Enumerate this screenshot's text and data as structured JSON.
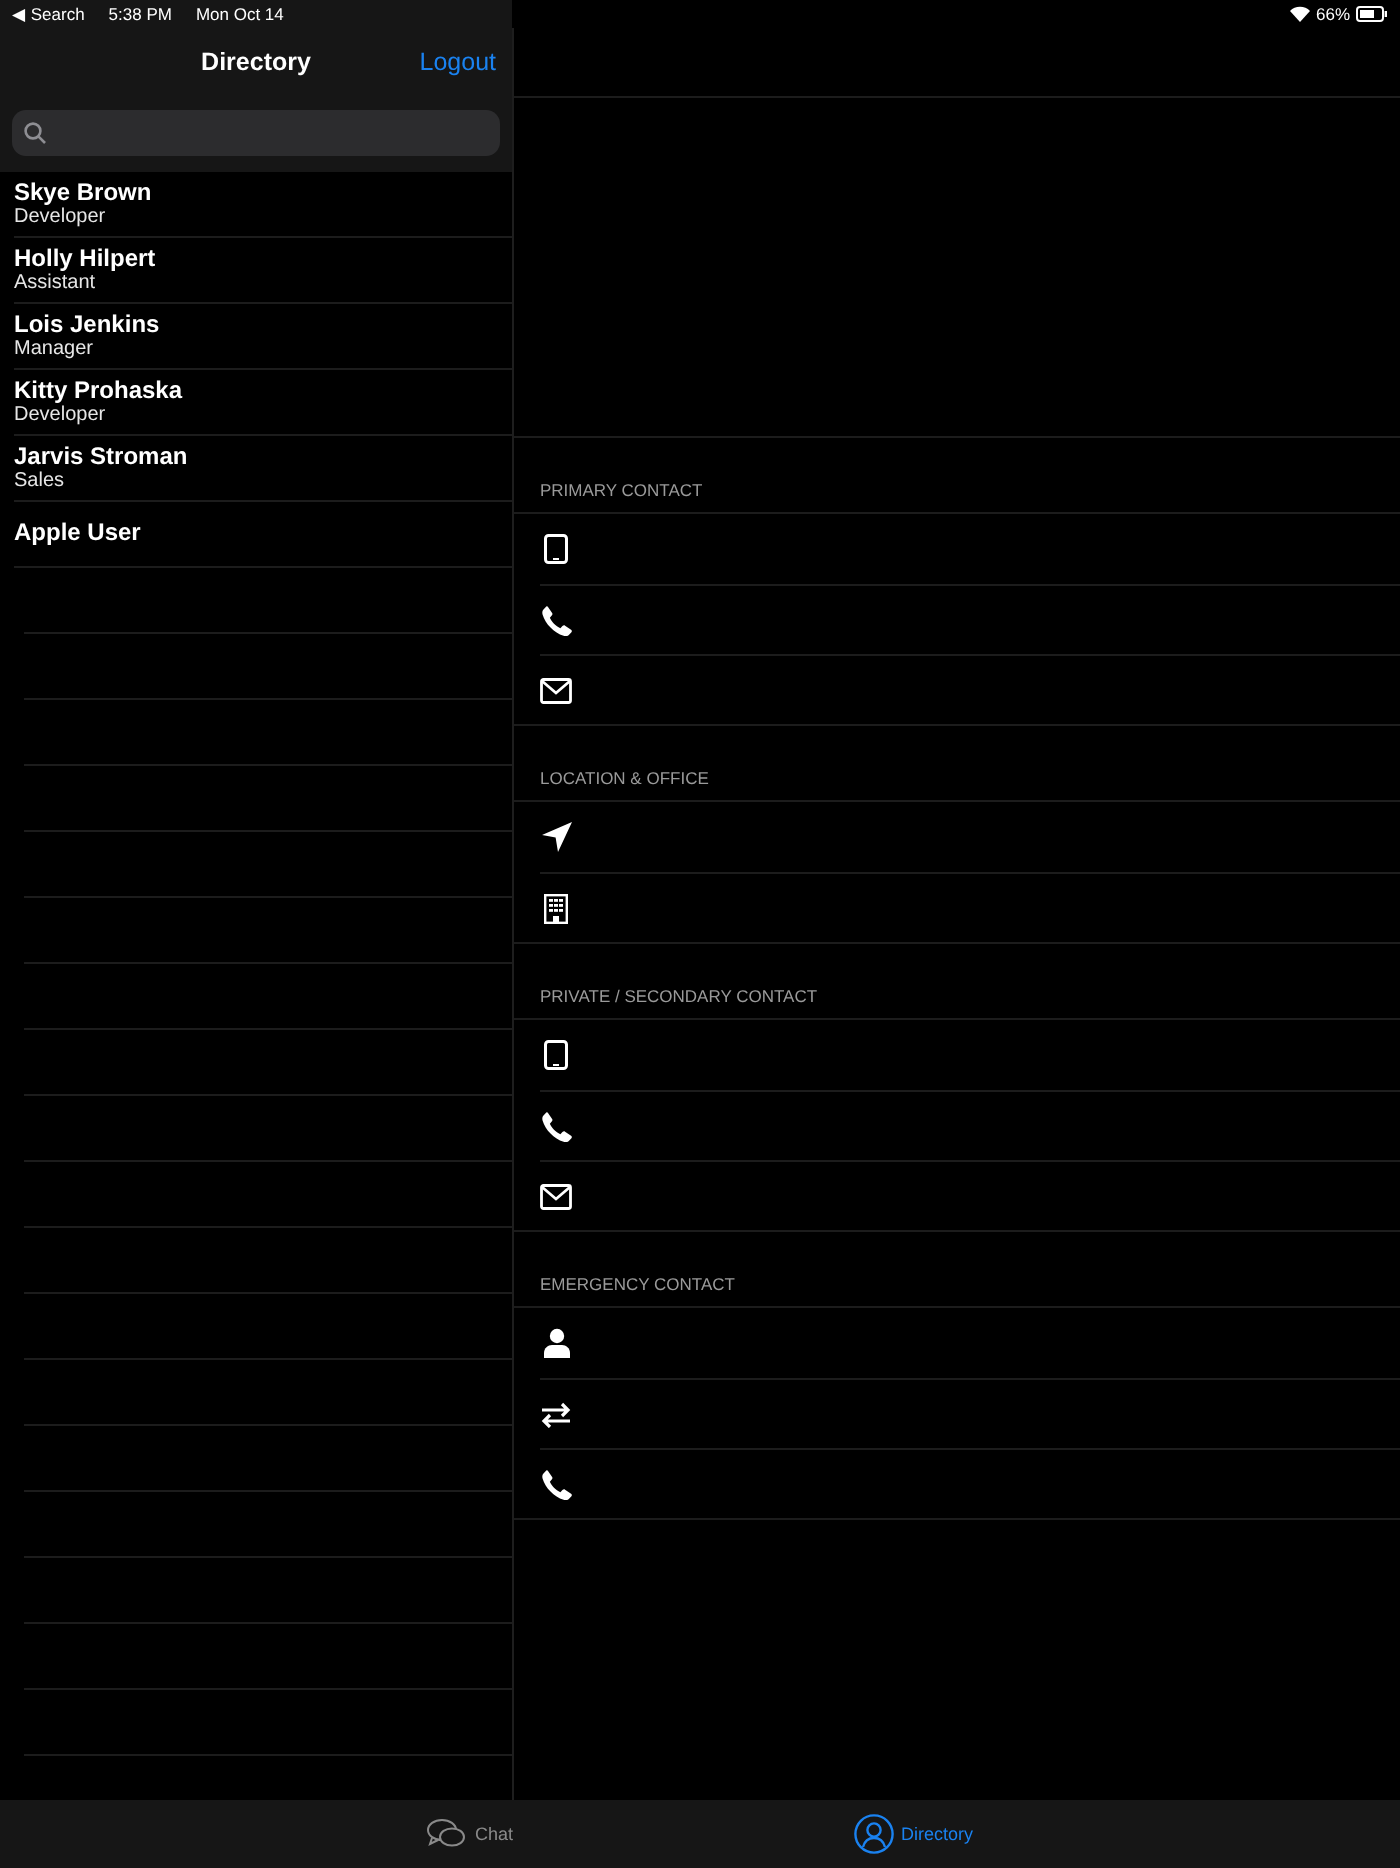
{
  "status_bar": {
    "back": "◀ Search",
    "time": "5:38 PM",
    "date": "Mon Oct 14",
    "battery": "66%"
  },
  "sidebar": {
    "title": "Directory",
    "logout": "Logout",
    "people": [
      {
        "name": "Skye Brown",
        "role": "Developer"
      },
      {
        "name": "Holly Hilpert",
        "role": "Assistant"
      },
      {
        "name": "Lois Jenkins",
        "role": "Manager"
      },
      {
        "name": "Kitty Prohaska",
        "role": "Developer"
      },
      {
        "name": "Jarvis Stroman",
        "role": "Sales"
      },
      {
        "name": "Apple User"
      }
    ]
  },
  "detail": {
    "sections": [
      {
        "title": "PRIMARY CONTACT",
        "rows": [
          {
            "kind": "tablet"
          },
          {
            "kind": "phone"
          },
          {
            "kind": "mail"
          }
        ]
      },
      {
        "title": "LOCATION & OFFICE",
        "rows": [
          {
            "kind": "location"
          },
          {
            "kind": "building"
          }
        ]
      },
      {
        "title": "PRIVATE / SECONDARY CONTACT",
        "rows": [
          {
            "kind": "tablet"
          },
          {
            "kind": "phone"
          },
          {
            "kind": "mail"
          }
        ]
      },
      {
        "title": "EMERGENCY CONTACT",
        "rows": [
          {
            "kind": "person"
          },
          {
            "kind": "swap"
          },
          {
            "kind": "phone"
          }
        ]
      }
    ]
  },
  "tabs": [
    {
      "label": "Chat",
      "kind": "chat",
      "selected": false
    },
    {
      "label": "Directory",
      "kind": "contacts",
      "selected": true
    }
  ]
}
